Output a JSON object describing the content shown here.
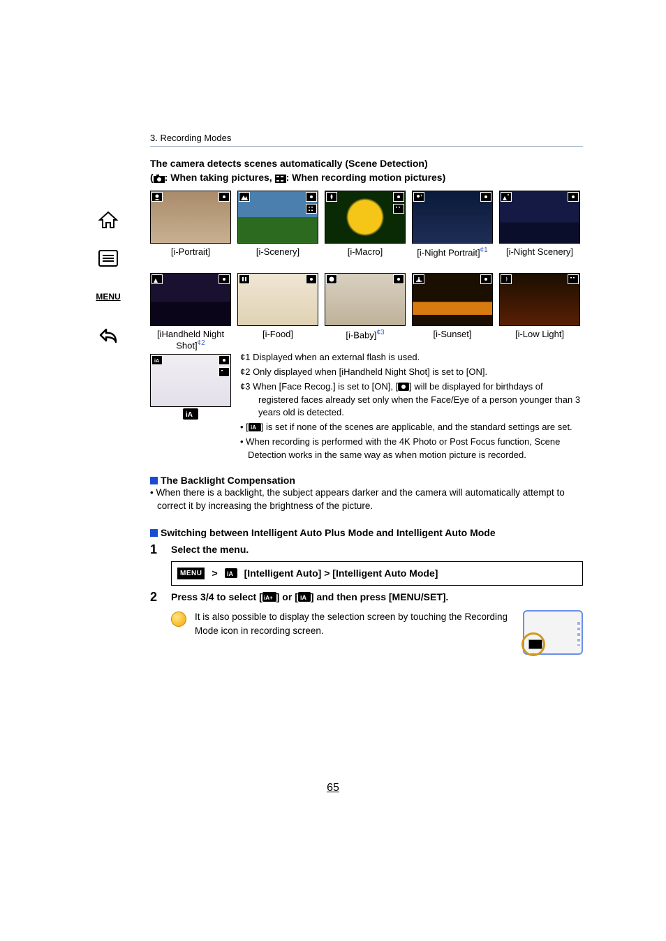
{
  "section_label": "3. Recording Modes",
  "heading_line1": "The camera detects scenes automatically (Scene Detection)",
  "heading_line2a": "(",
  "heading_line2b": ": When taking pictures, ",
  "heading_line2c": ": When recording motion pictures)",
  "scenes_row1": [
    {
      "label": "[i-Portrait]"
    },
    {
      "label": "[i-Scenery]"
    },
    {
      "label": "[i-Macro]"
    },
    {
      "label": "[i-Night Portrait]",
      "sup": "¢1"
    },
    {
      "label": "[i-Night Scenery]"
    }
  ],
  "scenes_row2": [
    {
      "label_a": "[iHandheld Night",
      "label_b": "Shot]",
      "sup": "¢2"
    },
    {
      "label": "[i-Food]"
    },
    {
      "label": "[i-Baby]",
      "sup": "¢3"
    },
    {
      "label": "[i-Sunset]"
    },
    {
      "label": "[i-Low Light]"
    }
  ],
  "footnotes": {
    "f1": "¢1 Displayed when an external flash is used.",
    "f2": "¢2 Only displayed when [iHandheld Night Shot] is set to [ON].",
    "f3a": "¢3 When [Face Recog.] is set to [ON], [",
    "f3b": "] will be displayed for birthdays of registered faces already set only when the Face/Eye of a person younger than 3 years old is detected."
  },
  "bullets": {
    "b1a": "• [",
    "b1b": "] is set if none of the scenes are applicable, and the standard settings are set.",
    "b2": "• When recording is performed with the 4K Photo or Post Focus function, Scene Detection works in the same way as when motion picture is recorded."
  },
  "backlight_head": "The Backlight Compensation",
  "backlight_body": "• When there is a backlight, the subject appears darker and the camera will automatically attempt to correct it by increasing the brightness of the picture.",
  "switch_head": "Switching between Intelligent Auto Plus Mode and Intelligent Auto Mode",
  "step1_label": "1",
  "step1_text": "Select the menu.",
  "menu_chip": "MENU",
  "menu_arrow": ">",
  "menu_path": " [Intelligent Auto] > [Intelligent Auto Mode]",
  "step2_label": "2",
  "step2_a": "Press 3/4 to select [",
  "step2_b": "] or [",
  "step2_c": "] and then press [MENU/SET].",
  "tip_text": "It is also possible to display the selection screen by touching the Recording Mode icon in recording screen.",
  "page_number": "65"
}
